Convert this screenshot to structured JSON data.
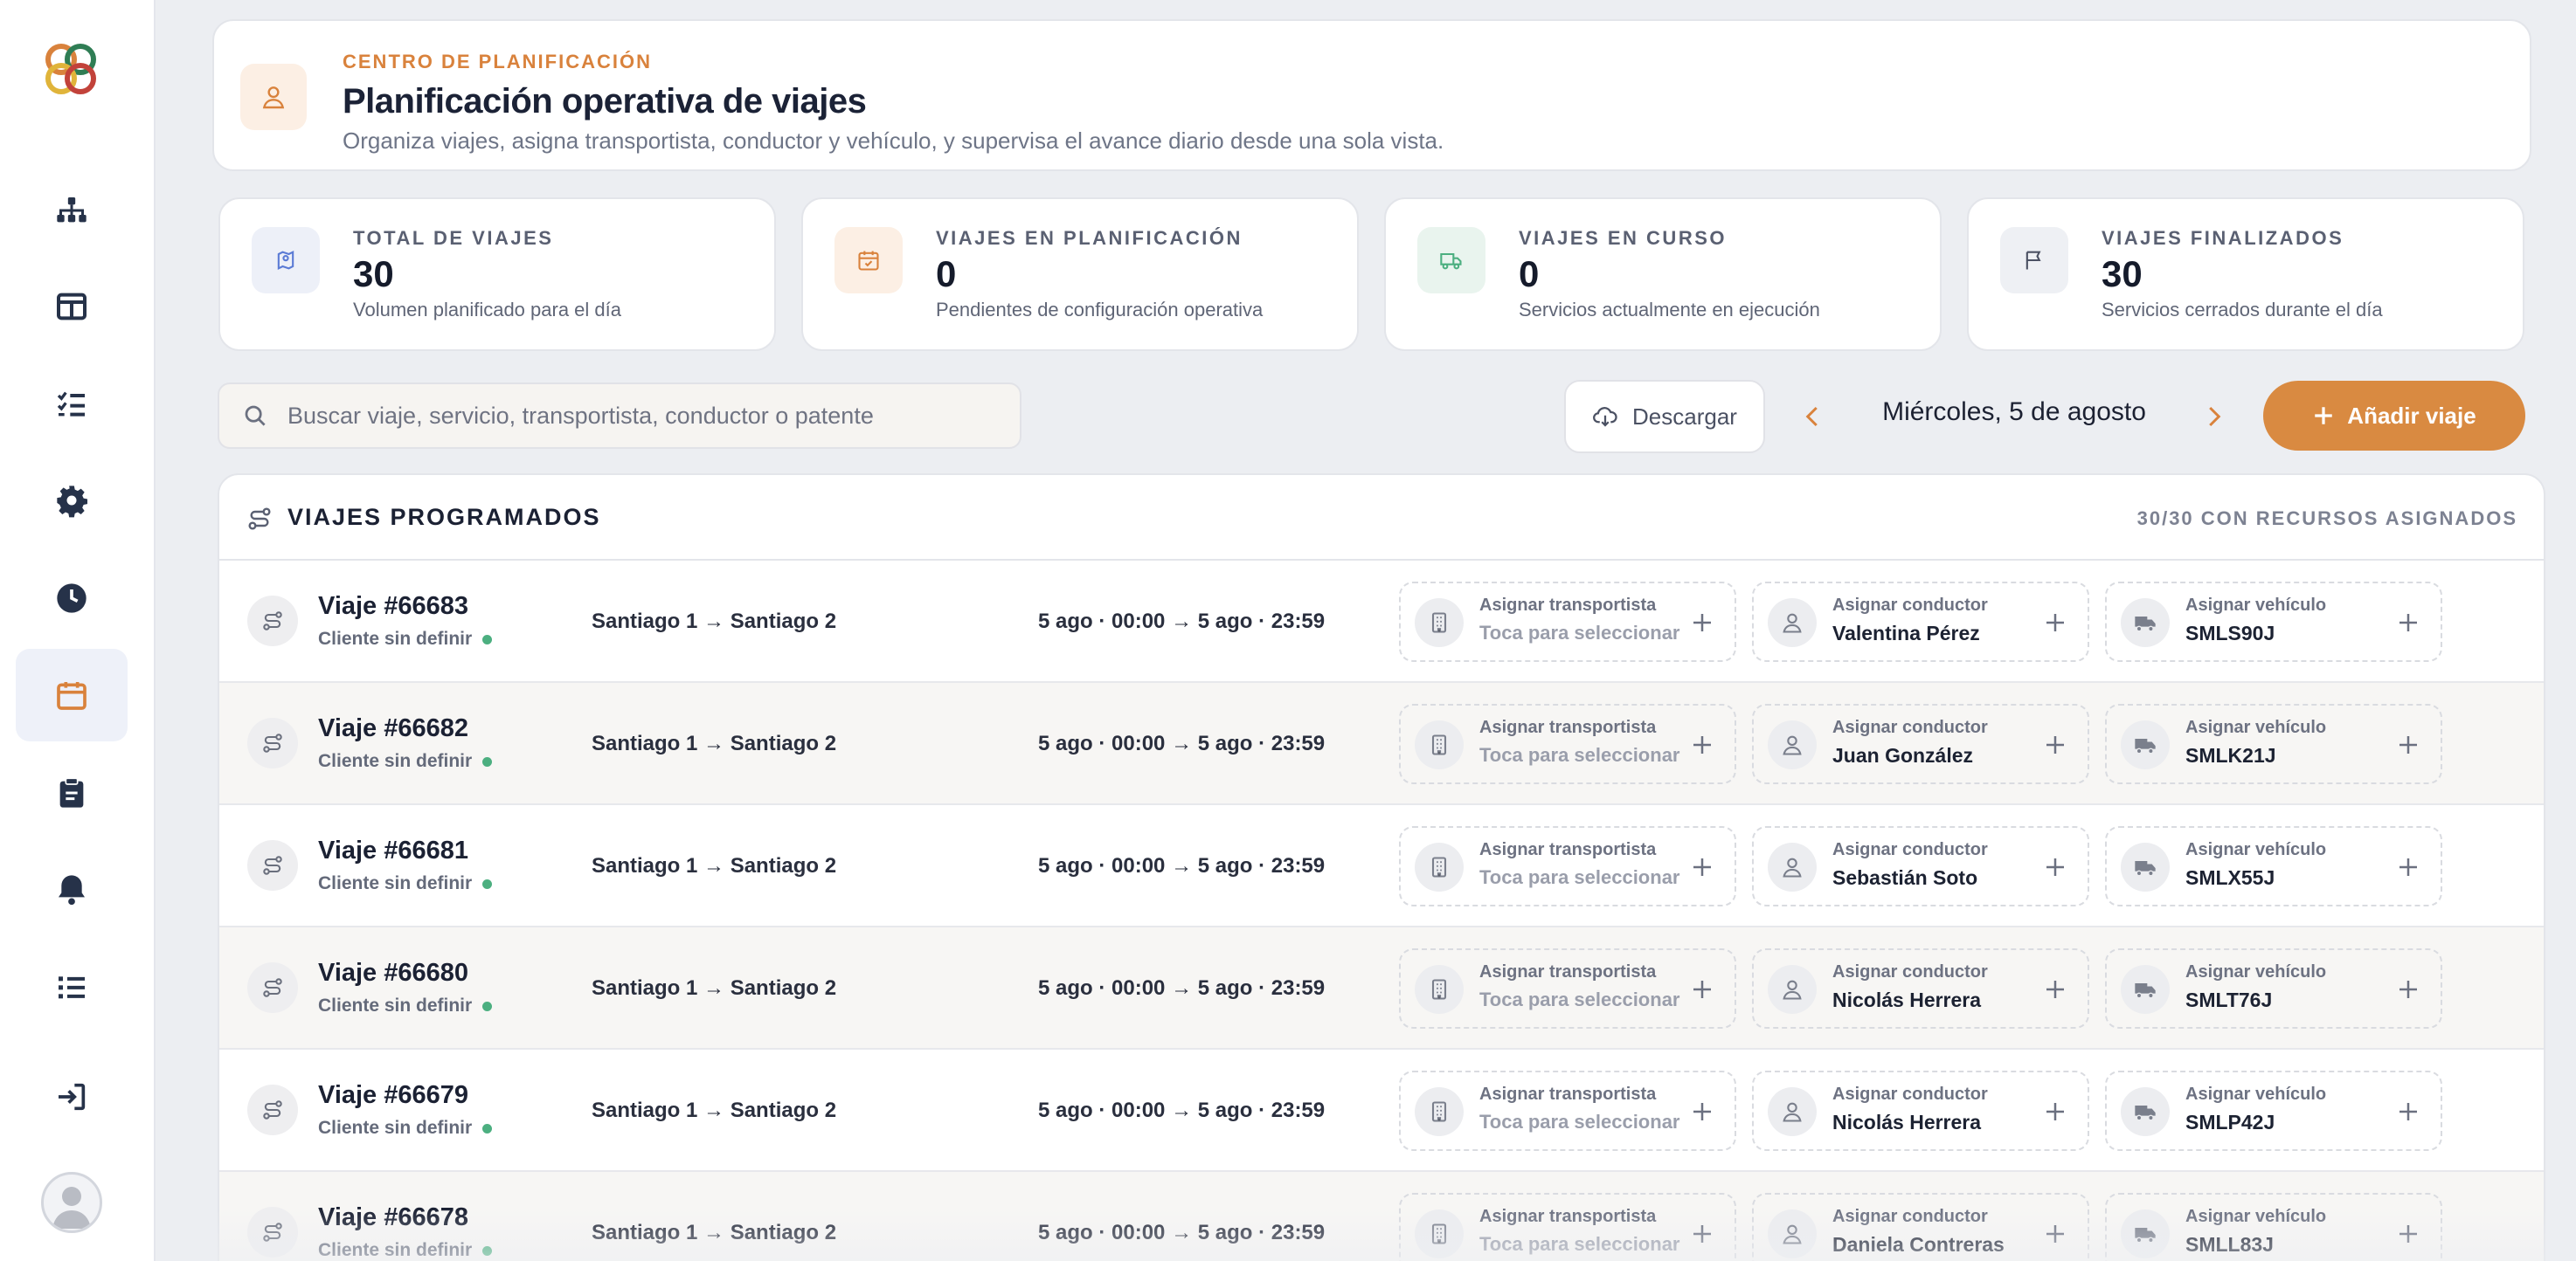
{
  "sidebar": {
    "logo": "app-logo",
    "items": [
      {
        "name": "org-chart-icon",
        "active": false
      },
      {
        "name": "layout-icon",
        "active": false
      },
      {
        "name": "checklist-icon",
        "active": false
      },
      {
        "name": "gear-icon",
        "active": false
      },
      {
        "name": "clock-icon",
        "active": false
      },
      {
        "name": "calendar-icon",
        "active": true
      },
      {
        "name": "clipboard-icon",
        "active": false
      },
      {
        "name": "bell-icon",
        "active": false
      },
      {
        "name": "list-icon",
        "active": false
      },
      {
        "name": "login-icon",
        "active": false
      }
    ],
    "avatar": "user-avatar"
  },
  "header": {
    "eyebrow": "CENTRO DE PLANIFICACIÓN",
    "title": "Planificación operativa de viajes",
    "subtitle": "Organiza viajes, asigna transportista, conductor y vehículo, y supervisa el avance diario desde una sola vista."
  },
  "stats": [
    {
      "label": "TOTAL DE VIAJES",
      "value": "30",
      "desc": "Volumen planificado para el día",
      "icon": "map-pin-icon",
      "color": "#5b7bd5",
      "bg": "#edf0f8"
    },
    {
      "label": "VIAJES EN PLANIFICACIÓN",
      "value": "0",
      "desc": "Pendientes de configuración operativa",
      "icon": "calendar-check-icon",
      "color": "#d9823c",
      "bg": "#fcefe4"
    },
    {
      "label": "VIAJES EN CURSO",
      "value": "0",
      "desc": "Servicios actualmente en ejecución",
      "icon": "truck-icon",
      "color": "#4caf80",
      "bg": "#e9f4ee"
    },
    {
      "label": "VIAJES FINALIZADOS",
      "value": "30",
      "desc": "Servicios cerrados durante el día",
      "icon": "flag-icon",
      "color": "#4b5163",
      "bg": "#eef0f4"
    }
  ],
  "toolbar": {
    "search_placeholder": "Buscar viaje, servicio, transportista, conductor o patente",
    "download_label": "Descargar",
    "date_label": "Miércoles, 5 de agosto",
    "add_label": "Añadir viaje"
  },
  "trips": {
    "title": "VIAJES PROGRAMADOS",
    "count_label": "30/30 CON RECURSOS ASIGNADOS",
    "labels": {
      "transport": "Asignar transportista",
      "transport_placeholder": "Toca para seleccionar",
      "driver": "Asignar conductor",
      "vehicle": "Asignar vehículo"
    },
    "rows": [
      {
        "id": "Viaje #66683",
        "client": "Cliente sin definir",
        "route": "Santiago 1 → Santiago 2",
        "time": "5 ago · 00:00 → 5 ago · 23:59",
        "driver": "Valentina Pérez",
        "vehicle": "SMLS90J"
      },
      {
        "id": "Viaje #66682",
        "client": "Cliente sin definir",
        "route": "Santiago 1 → Santiago 2",
        "time": "5 ago · 00:00 → 5 ago · 23:59",
        "driver": "Juan González",
        "vehicle": "SMLK21J"
      },
      {
        "id": "Viaje #66681",
        "client": "Cliente sin definir",
        "route": "Santiago 1 → Santiago 2",
        "time": "5 ago · 00:00 → 5 ago · 23:59",
        "driver": "Sebastián Soto",
        "vehicle": "SMLX55J"
      },
      {
        "id": "Viaje #66680",
        "client": "Cliente sin definir",
        "route": "Santiago 1 → Santiago 2",
        "time": "5 ago · 00:00 → 5 ago · 23:59",
        "driver": "Nicolás Herrera",
        "vehicle": "SMLT76J"
      },
      {
        "id": "Viaje #66679",
        "client": "Cliente sin definir",
        "route": "Santiago 1 → Santiago 2",
        "time": "5 ago · 00:00 → 5 ago · 23:59",
        "driver": "Nicolás Herrera",
        "vehicle": "SMLP42J"
      },
      {
        "id": "Viaje #66678",
        "client": "Cliente sin definir",
        "route": "Santiago 1 → Santiago 2",
        "time": "5 ago · 00:00 → 5 ago · 23:59",
        "driver": "Daniela Contreras",
        "vehicle": "SMLL83J"
      }
    ]
  },
  "colors": {
    "accent": "#d98a41",
    "status_green": "#4caf80",
    "nav_icon": "#263249"
  }
}
